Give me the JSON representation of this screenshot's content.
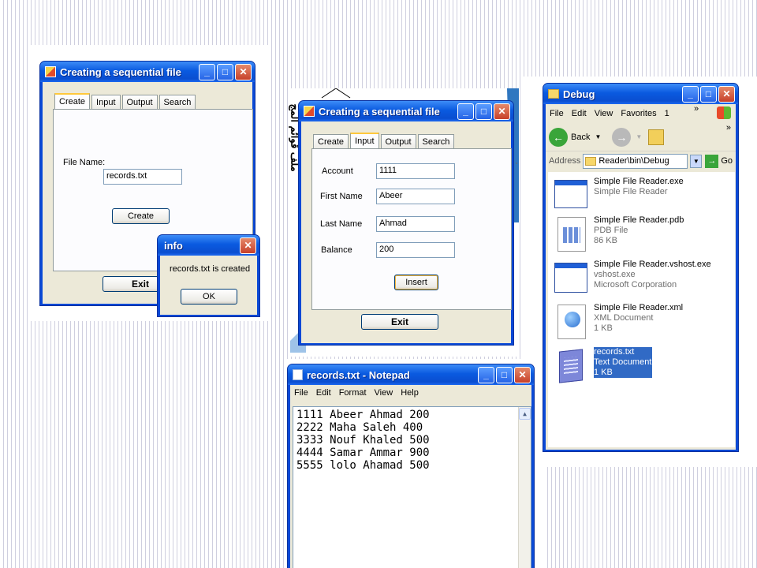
{
  "win1": {
    "title": "Creating a sequential file",
    "tabs": [
      "Create",
      "Input",
      "Output",
      "Search"
    ],
    "file_name_label": "File Name:",
    "file_name_value": "records.txt",
    "create_button": "Create",
    "exit_button": "Exit"
  },
  "info_dialog": {
    "title": "info",
    "message": "records.txt is created",
    "ok_button": "OK"
  },
  "win2": {
    "title": "Creating a sequential file",
    "tabs": [
      "Create",
      "Input",
      "Output",
      "Search"
    ],
    "fields": [
      {
        "label": "Account",
        "value": "1111"
      },
      {
        "label": "First Name",
        "value": "Abeer"
      },
      {
        "label": "Last Name",
        "value": "Ahmad"
      },
      {
        "label": "Balance",
        "value": "200"
      }
    ],
    "insert_button": "Insert",
    "exit_button": "Exit"
  },
  "background_doc": {
    "vertical_text": "ملف قوائم المج"
  },
  "notepad": {
    "title": "records.txt - Notepad",
    "menu": [
      "File",
      "Edit",
      "Format",
      "View",
      "Help"
    ],
    "lines": [
      "1111 Abeer Ahmad 200",
      "2222 Maha Saleh 400",
      "3333 Nouf Khaled 500",
      "4444 Samar Ammar 900",
      "5555 lolo Ahamad 500"
    ]
  },
  "explorer": {
    "title": "Debug",
    "menu": [
      "File",
      "Edit",
      "View",
      "Favorites",
      "1"
    ],
    "back_label": "Back",
    "address_label": "Address",
    "address_value": "Reader\\bin\\Debug",
    "go_label": "Go",
    "files": [
      {
        "name": "Simple File Reader.exe",
        "line2": "Simple File Reader",
        "line3": "",
        "icon": "exe-window-icon"
      },
      {
        "name": "Simple File Reader.pdb",
        "line2": "PDB File",
        "line3": "86 KB",
        "icon": "pdb-file-icon"
      },
      {
        "name": "Simple File Reader.vshost.exe",
        "line2": "vshost.exe",
        "line3": "Microsoft Corporation",
        "icon": "exe-window-icon"
      },
      {
        "name": "Simple File Reader.xml",
        "line2": "XML Document",
        "line3": "1 KB",
        "icon": "xml-document-icon"
      },
      {
        "name": "records.txt",
        "line2": "Text Document",
        "line3": "1 KB",
        "icon": "notepad-text-icon"
      }
    ]
  }
}
